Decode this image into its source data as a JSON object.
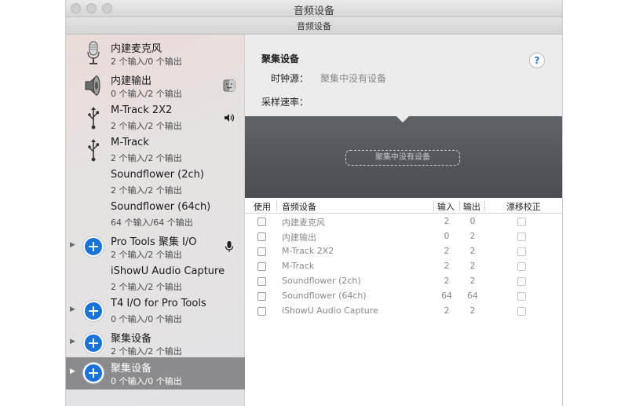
{
  "window": {
    "title": "音频设备",
    "subtitle": "音频设备"
  },
  "sidebar": {
    "items": [
      {
        "name": "内建麦克风",
        "io": "2 个输入/0 个输出",
        "icon": "microphone-icon"
      },
      {
        "name": "内建输出",
        "io": "0 个输入/2 个输出",
        "icon": "speaker-icon",
        "side_icon": "finder-icon"
      },
      {
        "name": "M-Track 2X2",
        "io": "2 个输入/2 个输出",
        "icon": "usb-icon",
        "side_icon": "volume-icon"
      },
      {
        "name": "M-Track",
        "io": "2 个输入/2 个输出",
        "icon": "usb-icon"
      },
      {
        "name": "Soundflower (2ch)",
        "io": "2 个输入/2 个输出"
      },
      {
        "name": "Soundflower (64ch)",
        "io": "64 个输入/64 个输出"
      },
      {
        "name": "Pro Tools 聚集 I/O",
        "io": "2 个输入/2 个输出",
        "icon": "aggregate-plus-icon",
        "side_icon": "microphone-small-icon"
      },
      {
        "name": "iShowU Audio Capture",
        "io": "2 个输入/2 个输出"
      },
      {
        "name": "T4 I/O for Pro Tools",
        "io": "0 个输入/0 个输出",
        "icon": "aggregate-plus-icon"
      },
      {
        "name": "聚集设备",
        "io": "2 个输入/2 个输出",
        "icon": "aggregate-plus-icon"
      },
      {
        "name": "聚集设备",
        "io": "0 个输入/0 个输出",
        "icon": "aggregate-plus-icon",
        "selected": true
      }
    ]
  },
  "detail": {
    "heading": "聚集设备",
    "clock_label": "时钟源：",
    "clock_value": "聚集中没有设备",
    "rate_label": "采样速率：",
    "help": "?",
    "empty_box": "聚集中没有设备"
  },
  "table": {
    "headers": {
      "use": "使用",
      "device": "音频设备",
      "in": "输入",
      "out": "输出",
      "drift": "漂移校正"
    },
    "rows": [
      {
        "device": "内建麦克风",
        "in": "2",
        "out": "0"
      },
      {
        "device": "内建输出",
        "in": "0",
        "out": "2"
      },
      {
        "device": "M-Track 2X2",
        "in": "2",
        "out": "2"
      },
      {
        "device": "M-Track",
        "in": "2",
        "out": "2"
      },
      {
        "device": "Soundflower (2ch)",
        "in": "2",
        "out": "2"
      },
      {
        "device": "Soundflower (64ch)",
        "in": "64",
        "out": "64"
      },
      {
        "device": "iShowU Audio Capture",
        "in": "2",
        "out": "2"
      }
    ]
  },
  "colors": {
    "accent": "#1a73d8",
    "selection": "#8b8b8d",
    "dark_panel": "#55585e"
  }
}
